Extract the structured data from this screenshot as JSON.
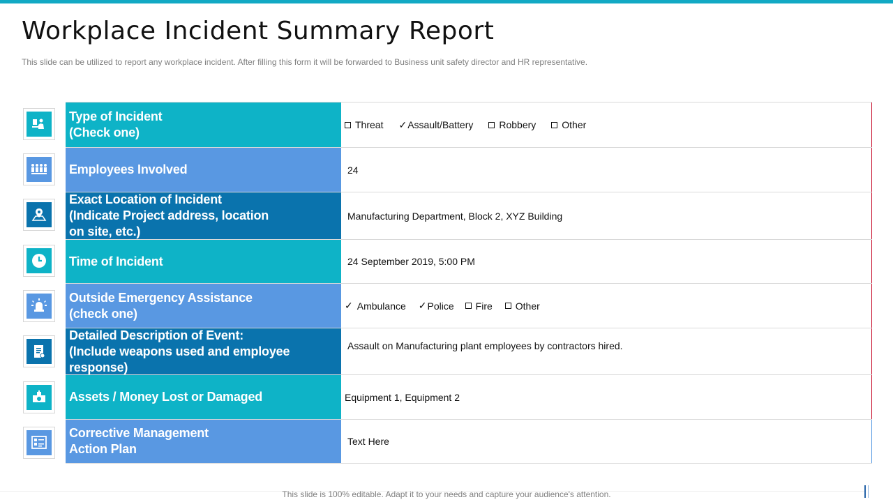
{
  "title": "Workplace Incident Summary Report",
  "subtitle": "This slide can be utilized to report any workplace incident. After filling this form it will be forwarded  to Business unit safety director and HR representative.",
  "rows": [
    {
      "label": "Type of Incident\n(Check one)",
      "icon": "meeting-icon",
      "options": [
        {
          "mark": "☐",
          "text": "Threat"
        },
        {
          "mark": "✓",
          "text": "Assault/Battery"
        },
        {
          "mark": "☐",
          "text": "Robbery"
        },
        {
          "mark": "☐",
          "text": "Other"
        }
      ]
    },
    {
      "label": "Employees Involved",
      "icon": "people-group-icon",
      "value": "24"
    },
    {
      "label": "Exact Location of Incident\n(Indicate Project address, location\non site, etc.)",
      "icon": "location-map-icon",
      "value": "Manufacturing Department, Block 2, XYZ  Building"
    },
    {
      "label": "Time of Incident",
      "icon": "clock-icon",
      "value": "24 September 2019, 5:00 PM"
    },
    {
      "label": "Outside Emergency Assistance\n(check one)",
      "icon": "emergency-siren-icon",
      "options": [
        {
          "mark": "✓",
          "text": "Ambulance"
        },
        {
          "mark": "✓",
          "text": "Police"
        },
        {
          "mark": "☐",
          "text": "Fire"
        },
        {
          "mark": "☐",
          "text": "Other"
        }
      ]
    },
    {
      "label": "Detailed Description of Event:\n(Include weapons used and employee\nresponse)",
      "icon": "document-report-icon",
      "value": "Assault on Manufacturing plant employees by contractors hired."
    },
    {
      "label": "Assets / Money Lost or Damaged",
      "icon": "money-icon",
      "value": "Equipment 1, Equipment 2"
    },
    {
      "label": "Corrective Management\n Action Plan",
      "icon": "planning-board-icon",
      "value": "Text Here"
    }
  ],
  "footer": "This slide is 100% editable. Adapt it to your needs and capture your audience's attention.",
  "colors": {
    "teal": "#0eb3c7",
    "blue": "#5998e2",
    "dark_blue": "#0a73ad",
    "accent_bar": "#12a9c4"
  }
}
